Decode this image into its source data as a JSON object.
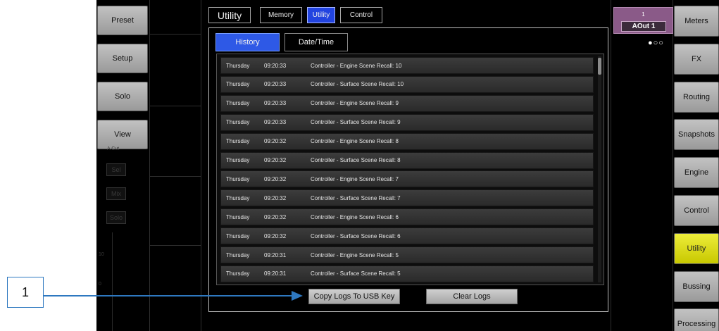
{
  "left_buttons": [
    {
      "label": "Preset"
    },
    {
      "label": "Setup"
    },
    {
      "label": "Solo"
    },
    {
      "label": "View"
    }
  ],
  "right_buttons": [
    {
      "label": "Meters",
      "active": false
    },
    {
      "label": "FX",
      "active": false
    },
    {
      "label": "Routing",
      "active": false
    },
    {
      "label": "Snapshots",
      "active": false
    },
    {
      "label": "Engine",
      "active": false
    },
    {
      "label": "Control",
      "active": false
    },
    {
      "label": "Utility",
      "active": true
    },
    {
      "label": "Bussing",
      "active": false
    },
    {
      "label": "Processing",
      "active": false
    }
  ],
  "ghost_strip": {
    "cut_label": "A Cut",
    "sel": "Sel",
    "mix": "Mix",
    "solo": "Solo",
    "scale_top": "10",
    "scale_bottom": "0"
  },
  "top_tabs": [
    {
      "label": "Utility",
      "selected": false
    },
    {
      "label": "Memory",
      "selected": false
    },
    {
      "label": "Utility",
      "selected": true
    },
    {
      "label": "Control",
      "selected": false
    }
  ],
  "sub_tabs": [
    {
      "label": "History",
      "selected": true
    },
    {
      "label": "Date/Time",
      "selected": false
    }
  ],
  "log_entries": [
    {
      "day": "Thursday",
      "time": "09:20:33",
      "event": "Controller - Engine Scene Recall: 10"
    },
    {
      "day": "Thursday",
      "time": "09:20:33",
      "event": "Controller - Surface Scene Recall: 10"
    },
    {
      "day": "Thursday",
      "time": "09:20:33",
      "event": "Controller - Engine Scene Recall: 9"
    },
    {
      "day": "Thursday",
      "time": "09:20:33",
      "event": "Controller - Surface Scene Recall: 9"
    },
    {
      "day": "Thursday",
      "time": "09:20:32",
      "event": "Controller - Engine Scene Recall: 8"
    },
    {
      "day": "Thursday",
      "time": "09:20:32",
      "event": "Controller - Surface Scene Recall: 8"
    },
    {
      "day": "Thursday",
      "time": "09:20:32",
      "event": "Controller - Engine Scene Recall: 7"
    },
    {
      "day": "Thursday",
      "time": "09:20:32",
      "event": "Controller - Surface Scene Recall: 7"
    },
    {
      "day": "Thursday",
      "time": "09:20:32",
      "event": "Controller - Engine Scene Recall: 6"
    },
    {
      "day": "Thursday",
      "time": "09:20:32",
      "event": "Controller - Surface Scene Recall: 6"
    },
    {
      "day": "Thursday",
      "time": "09:20:31",
      "event": "Controller - Engine Scene Recall: 5"
    },
    {
      "day": "Thursday",
      "time": "09:20:31",
      "event": "Controller - Surface Scene Recall: 5"
    }
  ],
  "actions": {
    "copy_label": "Copy Logs To USB Key",
    "clear_label": "Clear Logs"
  },
  "output_badge": {
    "number": "1",
    "name": "AOut 1"
  },
  "page_dots": "●○○",
  "callout": {
    "number": "1"
  },
  "colors": {
    "selected_tab": "#2e59e6",
    "active_side_button": "#e0e020",
    "output_badge": "#8a5a88",
    "callout_arrow": "#2e78c0"
  }
}
